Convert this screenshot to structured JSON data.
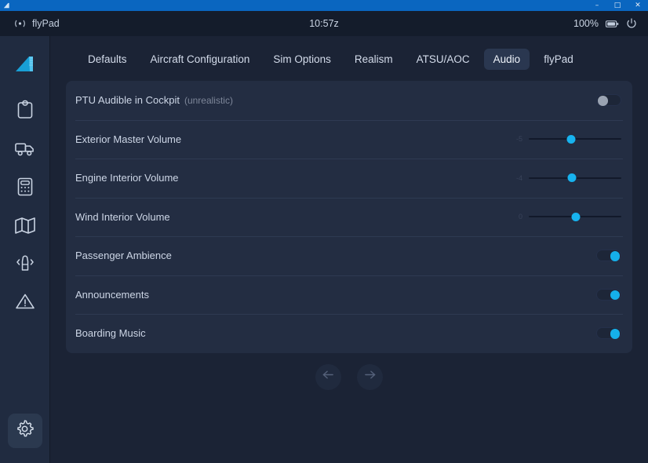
{
  "window": {
    "app_icon": "airplane-tail-icon",
    "minimize_label": "–",
    "maximize_label": "□",
    "close_label": "✕"
  },
  "statusbar": {
    "connection_icon": "signal-icon",
    "app_name": "flyPad",
    "time": "10:57z",
    "battery_percent": "100%",
    "battery_icon": "battery-icon",
    "power_icon": "power-icon"
  },
  "sidebar": {
    "items": [
      {
        "name": "logo",
        "icon": "airplane-tail-logo-icon",
        "active": false
      },
      {
        "name": "dispatch",
        "icon": "clipboard-icon",
        "active": false
      },
      {
        "name": "ground",
        "icon": "truck-icon",
        "active": false
      },
      {
        "name": "performance",
        "icon": "calculator-icon",
        "active": false
      },
      {
        "name": "navigation",
        "icon": "map-icon",
        "active": false
      },
      {
        "name": "atc",
        "icon": "beacon-icon",
        "active": false
      },
      {
        "name": "failures",
        "icon": "warning-triangle-icon",
        "active": false
      }
    ],
    "bottom": {
      "name": "settings",
      "icon": "gear-icon",
      "active": true
    }
  },
  "tabs": [
    {
      "label": "Defaults",
      "active": false
    },
    {
      "label": "Aircraft Configuration",
      "active": false
    },
    {
      "label": "Sim Options",
      "active": false
    },
    {
      "label": "Realism",
      "active": false
    },
    {
      "label": "ATSU/AOC",
      "active": false
    },
    {
      "label": "Audio",
      "active": true
    },
    {
      "label": "flyPad",
      "active": false
    }
  ],
  "settings": [
    {
      "label": "PTU Audible in Cockpit",
      "sublabel": "(unrealistic)",
      "control": "toggle",
      "value": "off"
    },
    {
      "label": "Exterior Master Volume",
      "sublabel": "",
      "control": "slider",
      "value": "-5",
      "percent": 46
    },
    {
      "label": "Engine Interior Volume",
      "sublabel": "",
      "control": "slider",
      "value": "-4",
      "percent": 47
    },
    {
      "label": "Wind Interior Volume",
      "sublabel": "",
      "control": "slider",
      "value": "0",
      "percent": 51
    },
    {
      "label": "Passenger Ambience",
      "sublabel": "",
      "control": "toggle",
      "value": "on"
    },
    {
      "label": "Announcements",
      "sublabel": "",
      "control": "toggle",
      "value": "on"
    },
    {
      "label": "Boarding Music",
      "sublabel": "",
      "control": "toggle",
      "value": "on"
    }
  ],
  "pager": {
    "prev_icon": "arrow-left-icon",
    "next_icon": "arrow-right-icon"
  },
  "colors": {
    "accent": "#17b3ef",
    "titlebar": "#0a66c0",
    "panel": "#232d42",
    "sidebar": "#202b40",
    "background": "#1b2335"
  }
}
